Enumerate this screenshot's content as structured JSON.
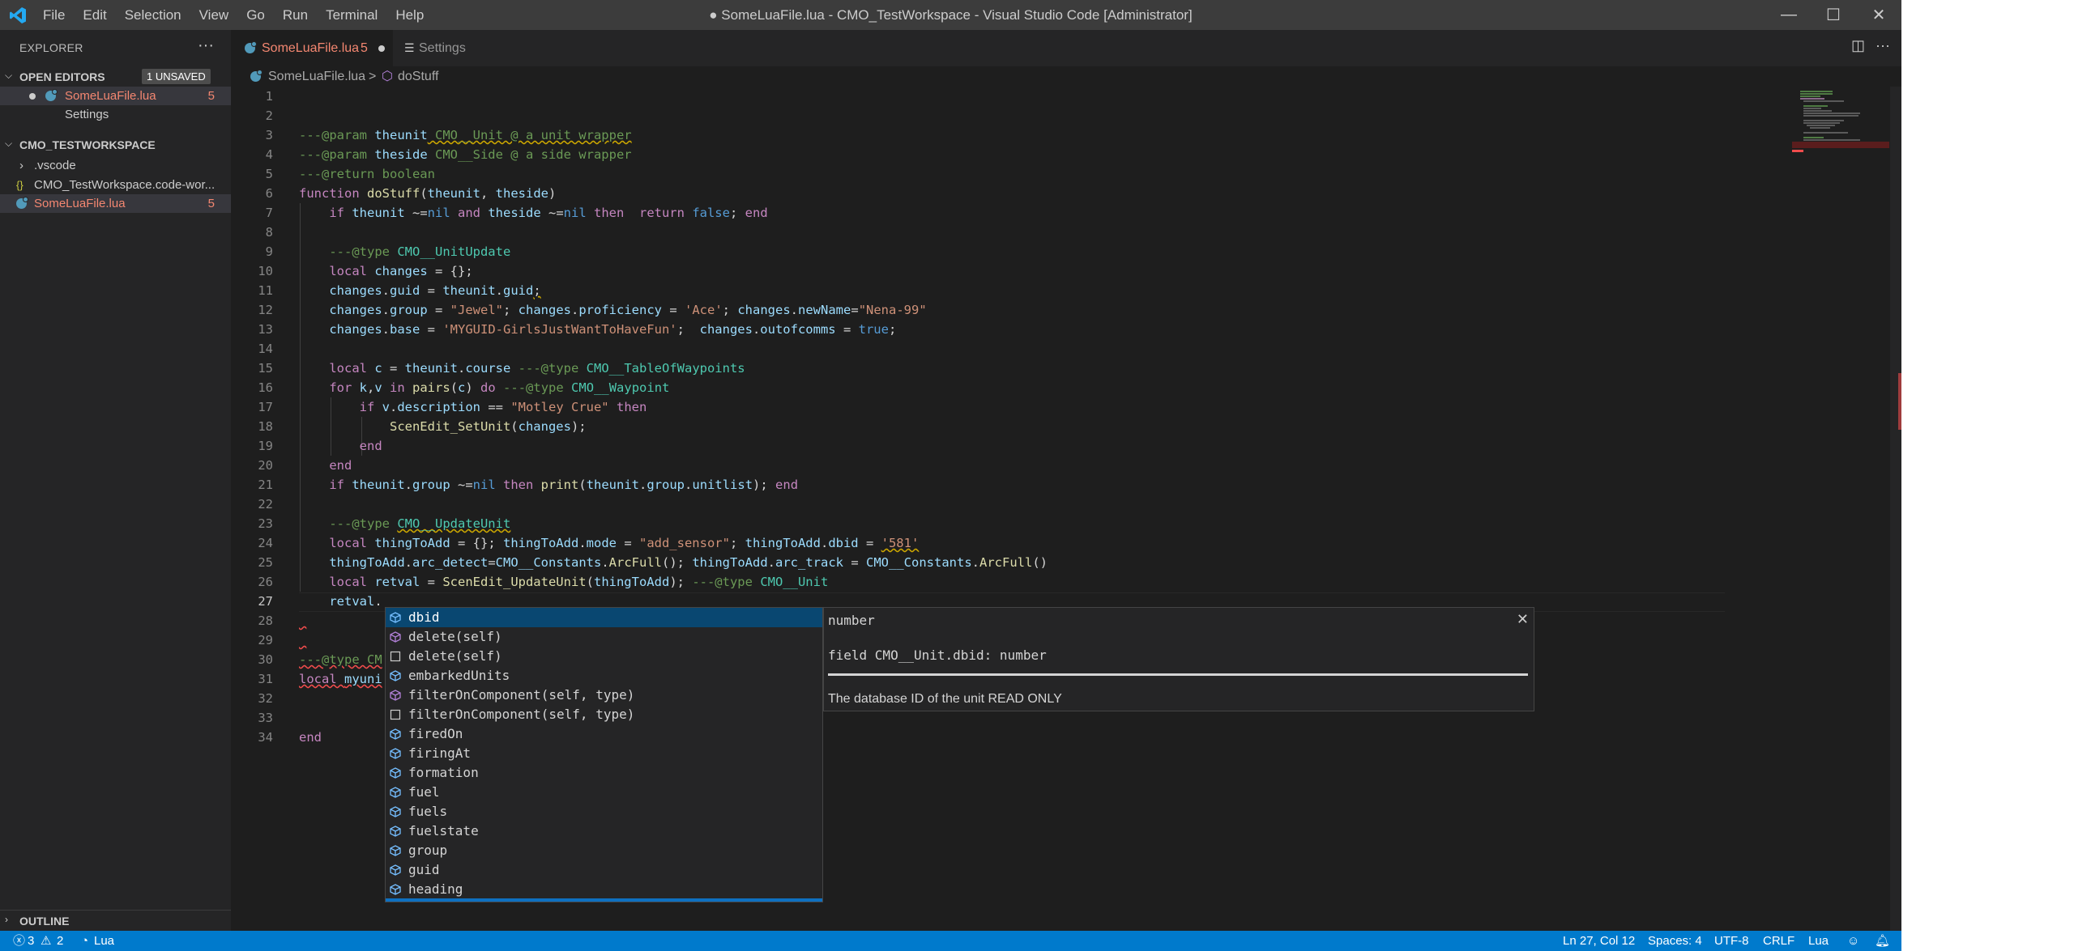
{
  "window": {
    "title": "● SomeLuaFile.lua - CMO_TestWorkspace - Visual Studio Code [Administrator]",
    "menu": [
      "File",
      "Edit",
      "Selection",
      "View",
      "Go",
      "Run",
      "Terminal",
      "Help"
    ],
    "controls": {
      "minimize": "—",
      "restore": "☐",
      "close": "✕"
    }
  },
  "sidebar": {
    "title": "EXPLORER",
    "more": "···",
    "open_editors": {
      "label": "OPEN EDITORS",
      "badge": "1 UNSAVED",
      "items": [
        {
          "label": "SomeLuaFile.lua",
          "count": "5"
        },
        {
          "label": "Settings"
        }
      ]
    },
    "workspace": {
      "label": "CMO_TESTWORKSPACE",
      "items": [
        {
          "label": ".vscode"
        },
        {
          "label": "CMO_TestWorkspace.code-wor..."
        },
        {
          "label": "SomeLuaFile.lua",
          "count": "5"
        }
      ]
    },
    "outline": "OUTLINE"
  },
  "tabs": [
    {
      "label": "SomeLuaFile.lua",
      "count": "5"
    },
    {
      "label": "Settings"
    }
  ],
  "breadcrumb": {
    "file": "SomeLuaFile.lua",
    "sep": ">",
    "symbol": "doStuff"
  },
  "editor": {
    "current_line": 27,
    "lines": [
      {
        "n": "1"
      },
      {
        "n": "2"
      },
      {
        "n": "3"
      },
      {
        "n": "4"
      },
      {
        "n": "5"
      },
      {
        "n": "6"
      },
      {
        "n": "7"
      },
      {
        "n": "8"
      },
      {
        "n": "9"
      },
      {
        "n": "10"
      },
      {
        "n": "11"
      },
      {
        "n": "12"
      },
      {
        "n": "13"
      },
      {
        "n": "14"
      },
      {
        "n": "15"
      },
      {
        "n": "16"
      },
      {
        "n": "17"
      },
      {
        "n": "18"
      },
      {
        "n": "19"
      },
      {
        "n": "20"
      },
      {
        "n": "21"
      },
      {
        "n": "22"
      },
      {
        "n": "23"
      },
      {
        "n": "24"
      },
      {
        "n": "25"
      },
      {
        "n": "26"
      },
      {
        "n": "27"
      },
      {
        "n": "28"
      },
      {
        "n": "29"
      },
      {
        "n": "30"
      },
      {
        "n": "31"
      },
      {
        "n": "32"
      },
      {
        "n": "33"
      },
      {
        "n": "34"
      }
    ],
    "code": {
      "l3": [
        "---@param ",
        "theunit",
        " CMO__Unit @ a unit wrapper"
      ],
      "l4": [
        "---@param ",
        "theside",
        " CMO__Side @ a side wrapper"
      ],
      "l5": [
        "---@return boolean"
      ],
      "l6": [
        "function ",
        "doStuff",
        "(",
        "theunit",
        ", ",
        "theside",
        ")"
      ],
      "l7": [
        "    ",
        "if ",
        "theunit",
        " ~=",
        "nil",
        " and ",
        "theside",
        " ~=",
        "nil",
        " then  ",
        "return ",
        "false",
        "; ",
        "end"
      ],
      "l9": [
        "    ---@type ",
        "CMO__UnitUpdate"
      ],
      "l10": [
        "    ",
        "local ",
        "changes",
        " = {};"
      ],
      "l11": [
        "    ",
        "changes",
        ".",
        "guid",
        " = ",
        "theunit",
        ".",
        "guid",
        ";"
      ],
      "l12": [
        "    ",
        "changes",
        ".",
        "group",
        " = ",
        "\"Jewel\"",
        "; ",
        "changes",
        ".",
        "proficiency",
        " = ",
        "'Ace'",
        "; ",
        "changes",
        ".",
        "newName",
        "=",
        "\"Nena-99\""
      ],
      "l13": [
        "    ",
        "changes",
        ".",
        "base",
        " = ",
        "'MYGUID-GirlsJustWantToHaveFun'",
        ";  ",
        "changes",
        ".",
        "outofcomms",
        " = ",
        "true",
        ";"
      ],
      "l15": [
        "    ",
        "local ",
        "c",
        " = ",
        "theunit",
        ".",
        "course",
        " ---@type ",
        "CMO__TableOfWaypoints"
      ],
      "l16": [
        "    ",
        "for ",
        "k",
        ",",
        "v",
        " in ",
        "pairs",
        "(",
        "c",
        ") ",
        "do",
        " ---@type ",
        "CMO__Waypoint"
      ],
      "l17": [
        "        ",
        "if ",
        "v",
        ".",
        "description",
        " == ",
        "\"Motley Crue\"",
        " then"
      ],
      "l18": [
        "            ",
        "ScenEdit_SetUnit",
        "(",
        "changes",
        ");"
      ],
      "l19": [
        "        ",
        "end"
      ],
      "l20": [
        "    ",
        "end"
      ],
      "l21": [
        "    ",
        "if ",
        "theunit",
        ".",
        "group",
        " ~=",
        "nil",
        " then ",
        "print",
        "(",
        "theunit",
        ".",
        "group",
        ".",
        "unitlist",
        "); ",
        "end"
      ],
      "l23": [
        "    ---@type ",
        "CMO__UpdateUnit"
      ],
      "l24": [
        "    ",
        "local ",
        "thingToAdd",
        " = {}; ",
        "thingToAdd",
        ".",
        "mode",
        " = ",
        "\"add_sensor\"",
        "; ",
        "thingToAdd",
        ".",
        "dbid",
        " = ",
        "'581'"
      ],
      "l25": [
        "    ",
        "thingToAdd",
        ".",
        "arc_detect",
        "=",
        "CMO__Constants",
        ".",
        "ArcFull",
        "(); ",
        "thingToAdd",
        ".",
        "arc_track",
        " = ",
        "CMO__Constants",
        ".",
        "ArcFull",
        "()"
      ],
      "l26": [
        "    ",
        "local ",
        "retval",
        " = ",
        "ScenEdit_UpdateUnit",
        "(",
        "thingToAdd",
        "); ",
        "---@type ",
        "CMO__Unit"
      ],
      "l27": [
        "    ",
        "retval",
        "."
      ],
      "l30": [
        "---@type CM"
      ],
      "l31": [
        "local ",
        "myuni"
      ],
      "l34": [
        "end"
      ]
    }
  },
  "suggest": {
    "items": [
      {
        "kind": "field",
        "label": "dbid",
        "selected": true
      },
      {
        "kind": "method",
        "label": "delete(self)"
      },
      {
        "kind": "keyword",
        "label": "delete(self)"
      },
      {
        "kind": "field",
        "label": "embarkedUnits"
      },
      {
        "kind": "method",
        "label": "filterOnComponent(self, type)"
      },
      {
        "kind": "keyword",
        "label": "filterOnComponent(self, type)"
      },
      {
        "kind": "field",
        "label": "firedOn"
      },
      {
        "kind": "field",
        "label": "firingAt"
      },
      {
        "kind": "field",
        "label": "formation"
      },
      {
        "kind": "field",
        "label": "fuel"
      },
      {
        "kind": "field",
        "label": "fuels"
      },
      {
        "kind": "field",
        "label": "fuelstate"
      },
      {
        "kind": "field",
        "label": "group"
      },
      {
        "kind": "field",
        "label": "guid"
      },
      {
        "kind": "field",
        "label": "heading"
      }
    ],
    "details": {
      "signature": "number",
      "close": "✕",
      "declaration": "field CMO__Unit.dbid: number",
      "doc": "The database ID of the unit READ ONLY"
    }
  },
  "status": {
    "errors": "3",
    "warnings": "2",
    "language_left": "Lua",
    "position": "Ln 27, Col 12",
    "spaces": "Spaces: 4",
    "encoding": "UTF-8",
    "eol": "CRLF",
    "language": "Lua"
  },
  "colors": {
    "accent": "#007acc",
    "titlebar": "#3c3c3c",
    "editor": "#1e1e1e",
    "sidebar": "#252526",
    "error": "#f48771"
  }
}
